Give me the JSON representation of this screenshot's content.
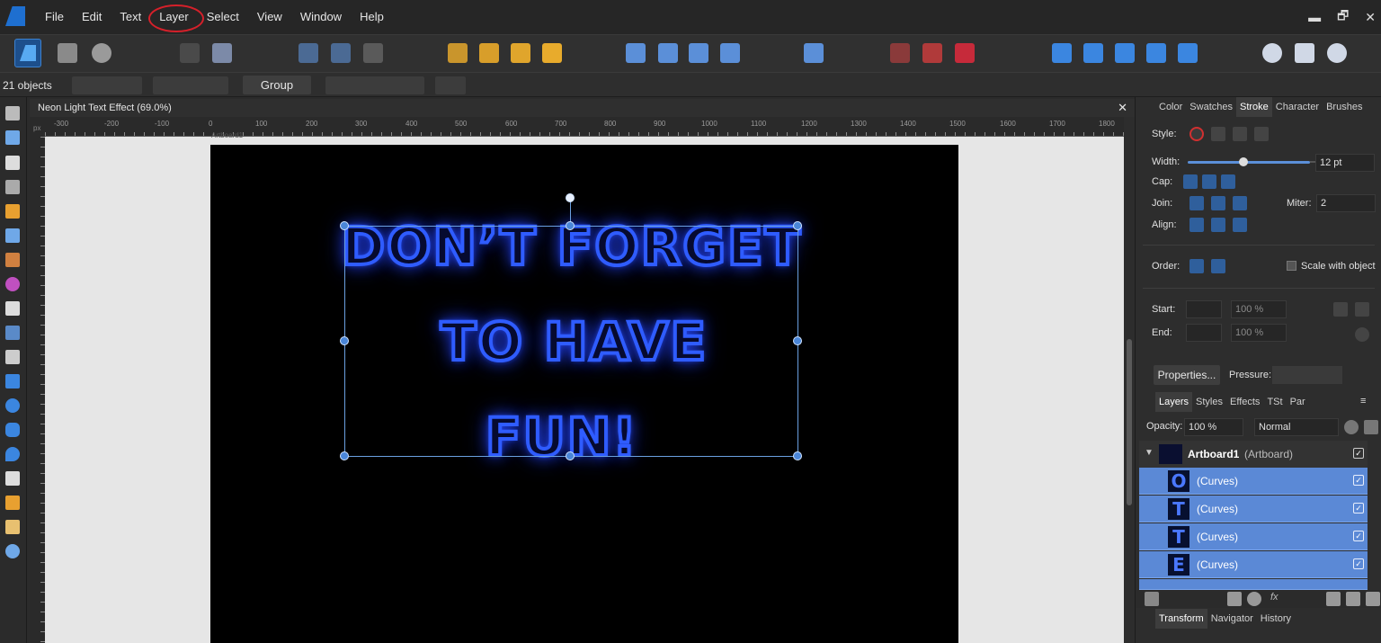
{
  "menu": [
    "File",
    "Edit",
    "Text",
    "Layer",
    "Select",
    "View",
    "Window",
    "Help"
  ],
  "window_controls": {
    "minimize": "▬",
    "restore": "🗗",
    "close": "✕"
  },
  "context": {
    "object_count": "21 objects",
    "group_label": "Group"
  },
  "document": {
    "title": "Neon Light Text Effect (69.0%)",
    "close": "✕",
    "ruler_unit": "px",
    "artboard_name": "Artboard1"
  },
  "ruler": {
    "h": [
      "-300",
      "-200",
      "-100",
      "0",
      "100",
      "200",
      "300",
      "400",
      "500",
      "600",
      "700",
      "800",
      "900",
      "1000",
      "1100",
      "1200",
      "1300",
      "1400",
      "1500",
      "1600",
      "1700",
      "1800"
    ]
  },
  "artwork": {
    "line1": "DON’T FORGET",
    "line2": "TO HAVE",
    "line3": "FUN!",
    "neon_color": "#2f5cff"
  },
  "stroke_panel": {
    "tabs": [
      "Color",
      "Swatches",
      "Stroke",
      "Character",
      "Brushes"
    ],
    "active_tab": "Stroke",
    "style_label": "Style:",
    "width_label": "Width:",
    "width_value": "12 pt",
    "cap_label": "Cap:",
    "join_label": "Join:",
    "miter_label": "Miter:",
    "miter_value": "2",
    "align_label": "Align:",
    "order_label": "Order:",
    "scale_label": "Scale with object",
    "start_label": "Start:",
    "end_label": "End:",
    "start_pct": "100 %",
    "end_pct": "100 %",
    "properties_label": "Properties...",
    "pressure_label": "Pressure:"
  },
  "layers_panel": {
    "tabs": [
      "Layers",
      "Styles",
      "Effects",
      "TSt",
      "Par"
    ],
    "opacity_label": "Opacity:",
    "opacity_value": "100 %",
    "blend_mode": "Normal",
    "artboard_name": "Artboard1",
    "artboard_type": "(Artboard)",
    "rows": [
      {
        "glyph": "O",
        "name": "(Curves)"
      },
      {
        "glyph": "T",
        "name": "(Curves)"
      },
      {
        "glyph": "T",
        "name": "(Curves)"
      },
      {
        "glyph": "E",
        "name": "(Curves)"
      }
    ]
  },
  "bottom_tabs": [
    "Transform",
    "Navigator",
    "History"
  ]
}
